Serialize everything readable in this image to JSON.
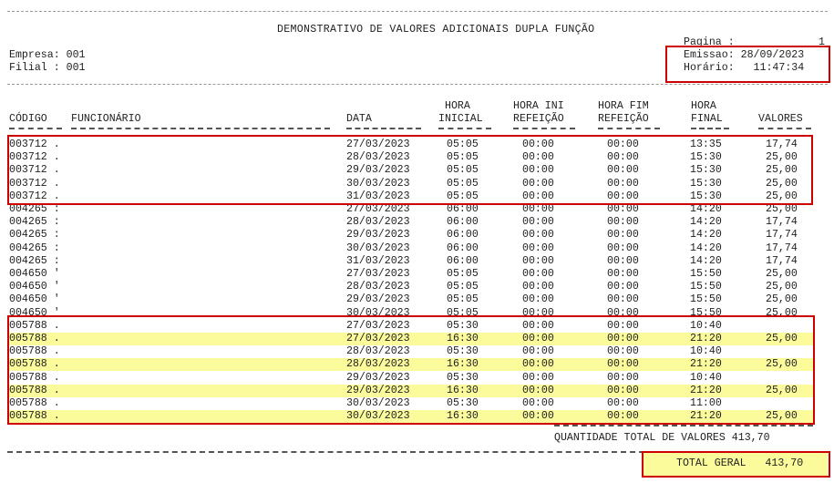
{
  "report": {
    "title": "DEMONSTRATIVO DE VALORES ADICIONAIS DUPLA FUNÇÃO",
    "pagina_label": "Pagina :",
    "pagina_value": "1",
    "empresa": "Empresa: 001",
    "filial": "Filial : 001",
    "emissao": "Emissao: 28/09/2023",
    "horario": "Horário:   11:47:34"
  },
  "columns": {
    "codigo": "CÓDIGO",
    "funcionario": "FUNCIONÁRIO",
    "data": "DATA",
    "hora_inicial_1": "HORA",
    "hora_inicial_2": "INICIAL",
    "hora_ini_ref_1": "HORA INI",
    "hora_ini_ref_2": "REFEIÇÃO",
    "hora_fim_ref_1": "HORA FIM",
    "hora_fim_ref_2": "REFEIÇÃO",
    "hora_final_1": "HORA",
    "hora_final_2": "FINAL",
    "valores": "VALORES"
  },
  "rows": [
    {
      "codigo": "003712 .",
      "data": "27/03/2023",
      "ini": "05:05",
      "ref_ini": "00:00",
      "ref_fim": "00:00",
      "fim": "13:35",
      "valor": "17,74",
      "hl": false
    },
    {
      "codigo": "003712 .",
      "data": "28/03/2023",
      "ini": "05:05",
      "ref_ini": "00:00",
      "ref_fim": "00:00",
      "fim": "15:30",
      "valor": "25,00",
      "hl": false
    },
    {
      "codigo": "003712 .",
      "data": "29/03/2023",
      "ini": "05:05",
      "ref_ini": "00:00",
      "ref_fim": "00:00",
      "fim": "15:30",
      "valor": "25,00",
      "hl": false
    },
    {
      "codigo": "003712 .",
      "data": "30/03/2023",
      "ini": "05:05",
      "ref_ini": "00:00",
      "ref_fim": "00:00",
      "fim": "15:30",
      "valor": "25,00",
      "hl": false
    },
    {
      "codigo": "003712 .",
      "data": "31/03/2023",
      "ini": "05:05",
      "ref_ini": "00:00",
      "ref_fim": "00:00",
      "fim": "15:30",
      "valor": "25,00",
      "hl": false
    },
    {
      "codigo": "004265 :",
      "data": "27/03/2023",
      "ini": "06:00",
      "ref_ini": "00:00",
      "ref_fim": "00:00",
      "fim": "14:20",
      "valor": "25,00",
      "hl": false
    },
    {
      "codigo": "004265 :",
      "data": "28/03/2023",
      "ini": "06:00",
      "ref_ini": "00:00",
      "ref_fim": "00:00",
      "fim": "14:20",
      "valor": "17,74",
      "hl": false
    },
    {
      "codigo": "004265 :",
      "data": "29/03/2023",
      "ini": "06:00",
      "ref_ini": "00:00",
      "ref_fim": "00:00",
      "fim": "14:20",
      "valor": "17,74",
      "hl": false
    },
    {
      "codigo": "004265 :",
      "data": "30/03/2023",
      "ini": "06:00",
      "ref_ini": "00:00",
      "ref_fim": "00:00",
      "fim": "14:20",
      "valor": "17,74",
      "hl": false
    },
    {
      "codigo": "004265 :",
      "data": "31/03/2023",
      "ini": "06:00",
      "ref_ini": "00:00",
      "ref_fim": "00:00",
      "fim": "14:20",
      "valor": "17,74",
      "hl": false
    },
    {
      "codigo": "004650 '",
      "data": "27/03/2023",
      "ini": "05:05",
      "ref_ini": "00:00",
      "ref_fim": "00:00",
      "fim": "15:50",
      "valor": "25,00",
      "hl": false
    },
    {
      "codigo": "004650 '",
      "data": "28/03/2023",
      "ini": "05:05",
      "ref_ini": "00:00",
      "ref_fim": "00:00",
      "fim": "15:50",
      "valor": "25,00",
      "hl": false
    },
    {
      "codigo": "004650 '",
      "data": "29/03/2023",
      "ini": "05:05",
      "ref_ini": "00:00",
      "ref_fim": "00:00",
      "fim": "15:50",
      "valor": "25,00",
      "hl": false
    },
    {
      "codigo": "004650 '",
      "data": "30/03/2023",
      "ini": "05:05",
      "ref_ini": "00:00",
      "ref_fim": "00:00",
      "fim": "15:50",
      "valor": "25,00",
      "hl": false
    },
    {
      "codigo": "005788 .",
      "data": "27/03/2023",
      "ini": "05:30",
      "ref_ini": "00:00",
      "ref_fim": "00:00",
      "fim": "10:40",
      "valor": "",
      "hl": false
    },
    {
      "codigo": "005788 .",
      "data": "27/03/2023",
      "ini": "16:30",
      "ref_ini": "00:00",
      "ref_fim": "00:00",
      "fim": "21:20",
      "valor": "25,00",
      "hl": true
    },
    {
      "codigo": "005788 .",
      "data": "28/03/2023",
      "ini": "05:30",
      "ref_ini": "00:00",
      "ref_fim": "00:00",
      "fim": "10:40",
      "valor": "",
      "hl": false
    },
    {
      "codigo": "005788 .",
      "data": "28/03/2023",
      "ini": "16:30",
      "ref_ini": "00:00",
      "ref_fim": "00:00",
      "fim": "21:20",
      "valor": "25,00",
      "hl": true
    },
    {
      "codigo": "005788 .",
      "data": "29/03/2023",
      "ini": "05:30",
      "ref_ini": "00:00",
      "ref_fim": "00:00",
      "fim": "10:40",
      "valor": "",
      "hl": false
    },
    {
      "codigo": "005788 .",
      "data": "29/03/2023",
      "ini": "16:30",
      "ref_ini": "00:00",
      "ref_fim": "00:00",
      "fim": "21:20",
      "valor": "25,00",
      "hl": true
    },
    {
      "codigo": "005788 .",
      "data": "30/03/2023",
      "ini": "05:30",
      "ref_ini": "00:00",
      "ref_fim": "00:00",
      "fim": "11:00",
      "valor": "",
      "hl": false
    },
    {
      "codigo": "005788 .",
      "data": "30/03/2023",
      "ini": "16:30",
      "ref_ini": "00:00",
      "ref_fim": "00:00",
      "fim": "21:20",
      "valor": "25,00",
      "hl": true
    }
  ],
  "totals": {
    "quantidade": "QUANTIDADE TOTAL DE VALORES 413,70",
    "total_geral": "TOTAL GERAL   413,70"
  },
  "colors": {
    "highlight": "#fbfb9c",
    "annotation_box": "#cc0000"
  }
}
